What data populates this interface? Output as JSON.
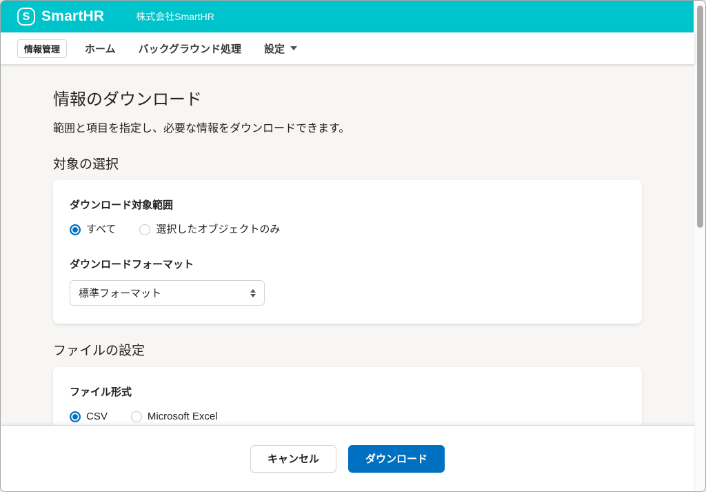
{
  "header": {
    "logo_letter": "S",
    "brand": "SmartHR",
    "company_name": "株式会社SmartHR"
  },
  "nav": {
    "current_app": "情報管理",
    "items": [
      {
        "label": "ホーム"
      },
      {
        "label": "バックグラウンド処理"
      },
      {
        "label": "設定",
        "has_dropdown": true
      }
    ]
  },
  "page": {
    "title": "情報のダウンロード",
    "description": "範囲と項目を指定し、必要な情報をダウンロードできます。"
  },
  "target_section": {
    "heading": "対象の選択",
    "range_label": "ダウンロード対象範囲",
    "range_options": [
      {
        "label": "すべて",
        "selected": true
      },
      {
        "label": "選択したオブジェクトのみ",
        "selected": false
      }
    ],
    "format_label": "ダウンロードフォーマット",
    "format_selected_value": "標準フォーマット"
  },
  "file_section": {
    "heading": "ファイルの設定",
    "format_label": "ファイル形式",
    "format_options": [
      {
        "label": "CSV",
        "selected": true
      },
      {
        "label": "Microsoft Excel",
        "selected": false
      }
    ]
  },
  "footer": {
    "cancel_label": "キャンセル",
    "download_label": "ダウンロード"
  },
  "colors": {
    "brand_teal": "#00c4cc",
    "primary_blue": "#0071c1",
    "page_background": "#f7f6f5",
    "border": "#d6d3d0",
    "text": "#23221e"
  }
}
